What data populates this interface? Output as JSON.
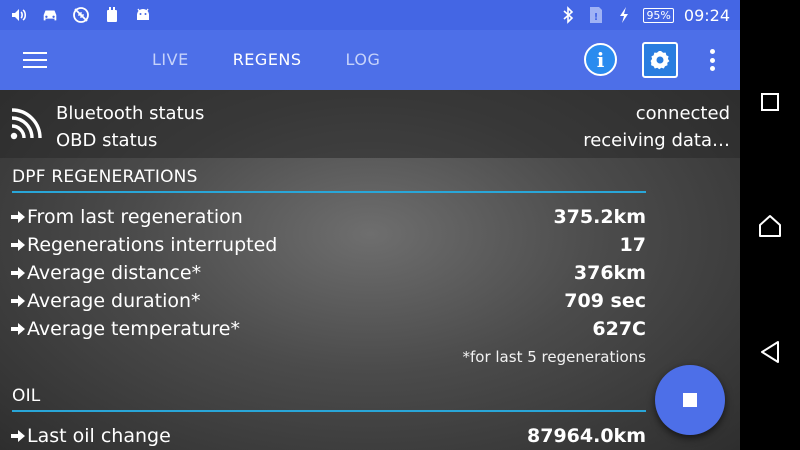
{
  "statusbar": {
    "icons": [
      "volume-icon",
      "car-icon",
      "no-network-icon",
      "sim-icon",
      "android-icon"
    ],
    "right_icons": [
      "bluetooth-icon",
      "sd-card-icon",
      "charging-icon"
    ],
    "battery": "95%",
    "time": "09:24"
  },
  "appbar": {
    "tabs": [
      {
        "label": "LIVE",
        "active": false
      },
      {
        "label": "REGENS",
        "active": true
      },
      {
        "label": "LOG",
        "active": false
      }
    ],
    "info_label": "i"
  },
  "status": {
    "bluetooth_label": "Bluetooth status",
    "bluetooth_value": "connected",
    "obd_label": "OBD status",
    "obd_value": "receiving data…"
  },
  "dpf": {
    "title": "DPF REGENERATIONS",
    "rows": [
      {
        "label": "From last regeneration",
        "value": "375.2km"
      },
      {
        "label": "Regenerations interrupted",
        "value": "17"
      },
      {
        "label": "Average distance*",
        "value": "376km"
      },
      {
        "label": "Average duration*",
        "value": "709 sec"
      },
      {
        "label": "Average temperature*",
        "value": "627C"
      }
    ],
    "footnote": "*for last 5 regenerations"
  },
  "oil": {
    "title": "OIL",
    "rows": [
      {
        "label": "Last oil change",
        "value": "87964.0km"
      }
    ]
  },
  "colors": {
    "appbar": "#4d6fe8",
    "statusbar": "#4466e4",
    "accent_line": "#29a6d8"
  }
}
